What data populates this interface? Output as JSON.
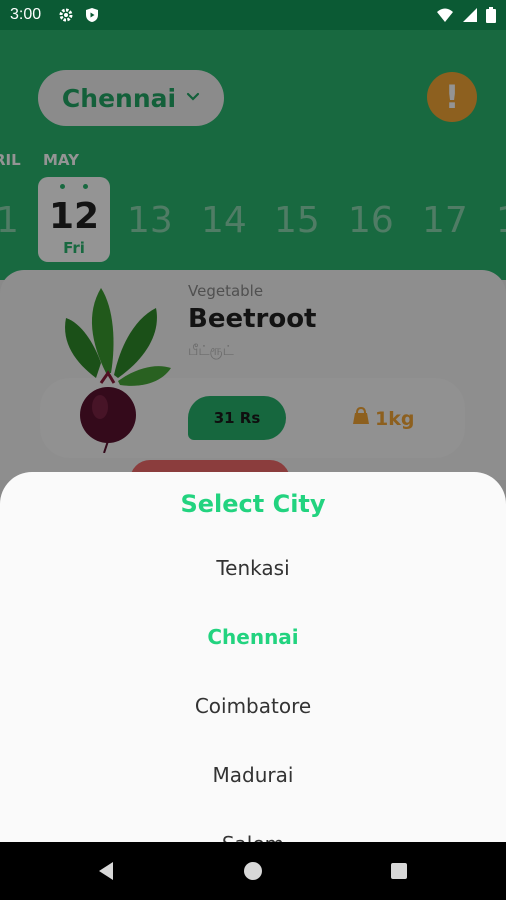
{
  "status_bar": {
    "time": "3:00",
    "icons_left": [
      "gear-icon",
      "play-protect-icon"
    ],
    "icons_right": [
      "wifi-icon",
      "signal-icon",
      "battery-icon"
    ]
  },
  "header": {
    "city": "Chennai",
    "dropdown_icon": "chevron-down-icon",
    "alert_label": "!",
    "months": {
      "prev": "RIL",
      "current": "MAY"
    },
    "dates": [
      "1",
      "13",
      "14",
      "15",
      "16",
      "17",
      "1"
    ],
    "selected_date": {
      "day": "12",
      "weekday": "Fri"
    },
    "colors": {
      "green": "#2ab56e",
      "orange": "#f3a636"
    }
  },
  "product_card": {
    "category": "Vegetable",
    "name": "Beetroot",
    "tamil_name": "பீட்ரூட்",
    "price": "31 Rs",
    "quantity": "1kg",
    "quantity_icon": "weight-bag-icon"
  },
  "city_sheet": {
    "title": "Select City",
    "cities": [
      {
        "name": "Tenkasi",
        "selected": false
      },
      {
        "name": "Chennai",
        "selected": true
      },
      {
        "name": "Coimbatore",
        "selected": false
      },
      {
        "name": "Madurai",
        "selected": false
      },
      {
        "name": "Salem",
        "selected": false
      }
    ],
    "accent": "#22d37f"
  },
  "nav_bar": {
    "buttons": [
      "back-icon",
      "home-icon",
      "recents-icon"
    ]
  }
}
